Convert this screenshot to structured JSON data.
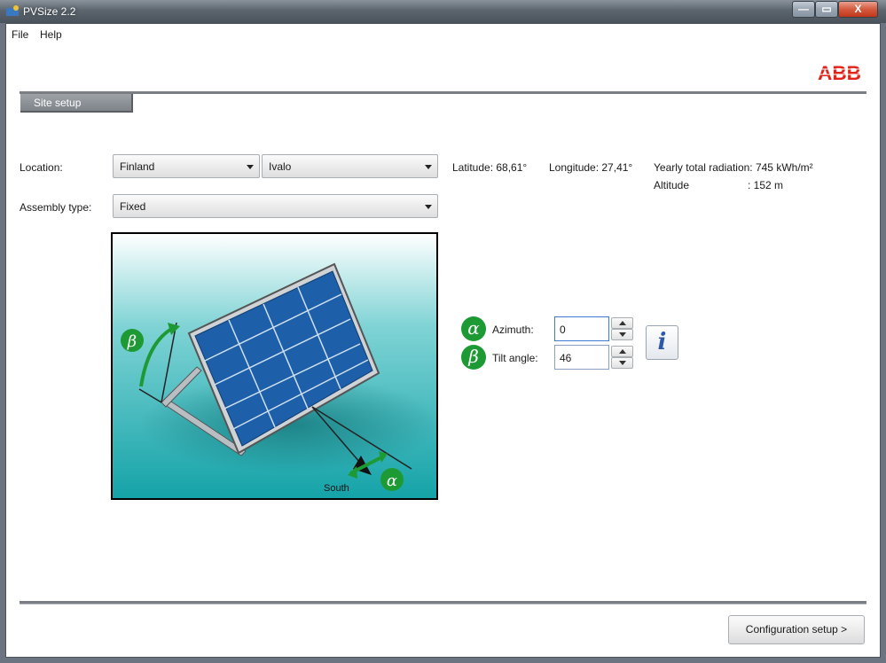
{
  "window": {
    "title": "PVSize 2.2",
    "min_label": "—",
    "max_label": "▭",
    "close_label": "X"
  },
  "menu": {
    "file": "File",
    "help": "Help"
  },
  "brand": {
    "logo_text": "ABB",
    "color": "#e2231a"
  },
  "tabs": [
    {
      "label": "Site setup"
    }
  ],
  "location": {
    "label": "Location:",
    "country": "Finland",
    "city": "Ivalo",
    "latitude": "Latitude: 68,61°",
    "longitude": "Longitude: 27,41°",
    "radiation": "Yearly total radiation: 745 kWh/m²",
    "altitude_label": "Altitude",
    "altitude_value": ": 152 m"
  },
  "assembly": {
    "label": "Assembly type:",
    "value": "Fixed"
  },
  "diagram": {
    "south_label": "South",
    "alpha_symbol": "α",
    "beta_symbol": "β"
  },
  "orientation": {
    "azimuth_label": "Azimuth:",
    "azimuth_value": "0",
    "tilt_label": "Tilt angle:",
    "tilt_value": "46",
    "info_symbol": "i"
  },
  "footer": {
    "next_button": "Configuration setup >"
  },
  "colors": {
    "accent_green": "#1e9a35",
    "panel_blue": "#1d5fa8",
    "sky_teal": "#2bb3b8"
  }
}
